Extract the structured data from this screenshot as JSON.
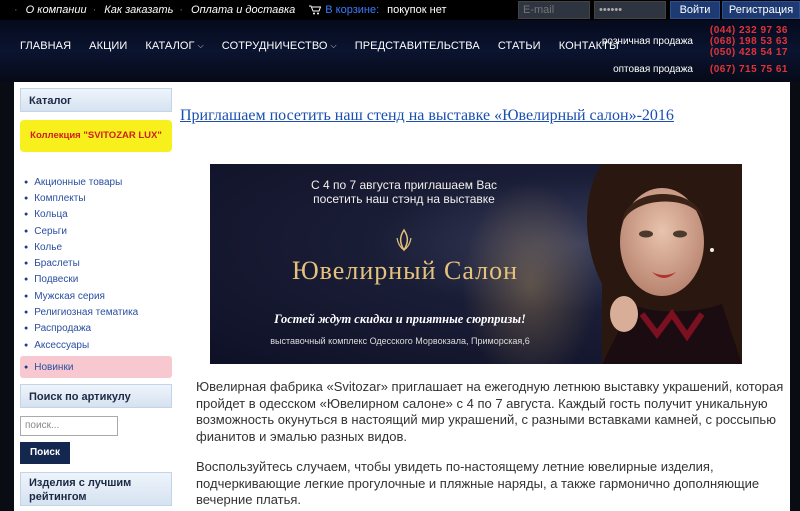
{
  "topbar": {
    "links": [
      "О компании",
      "Как заказать",
      "Оплата и доставка"
    ],
    "cart_label": "В корзине:",
    "cart_status": "покупок нет",
    "email_placeholder": "E-mail",
    "password_mask": "••••••",
    "login_label": "Войти",
    "register_label": "Регистрация"
  },
  "nav": {
    "items": [
      {
        "label": "ГЛАВНАЯ"
      },
      {
        "label": "АКЦИИ"
      },
      {
        "label": "КАТАЛОГ"
      },
      {
        "label": "СОТРУДНИЧЕСТВО"
      },
      {
        "label": "ПРЕДСТАВИТЕЛЬСТВА"
      },
      {
        "label": "СТАТЬИ"
      },
      {
        "label": "КОНТАКТЫ"
      }
    ]
  },
  "phones": {
    "retail_label": "розничная продажа",
    "retail_numbers": [
      "(044) 232 97 36",
      "(068) 198 53 63",
      "(050) 428 54 17"
    ],
    "wholesale_label": "оптовая продажа",
    "wholesale_number": "(067) 715 75 61"
  },
  "sidebar": {
    "catalog_title": "Каталог",
    "promo_label": "Коллекция \"SVITOZAR LUX\"",
    "menu": [
      "Акционные товары",
      "Комплекты",
      "Кольца",
      "Серьги",
      "Колье",
      "Браслеты",
      "Подвески",
      "Мужская серия",
      "Религиозная тематика",
      "Распродажа",
      "Аксессуары",
      "Новинки"
    ],
    "search_title": "Поиск по артикулу",
    "search_placeholder": "поиск...",
    "search_button": "Поиск",
    "rating_title": "Изделия с лучшим рейтингом"
  },
  "article": {
    "title": "Приглашаем посетить наш стенд на выставке «Ювелирный салон»-2016",
    "banner": {
      "line1": "С 4 по 7 августа приглашаем Вас",
      "line2": "посетить наш стэнд на выставке",
      "brand": "Ювелирный Салон",
      "slogan": "Гостей ждут скидки и приятные сюрпризы!",
      "venue": "выставочный комплекс Одесского Морвокзала, Приморская,6"
    },
    "paragraph1": "Ювелирная фабрика «Svitozar» приглашает на ежегодную летнюю выставку украшений, которая пройдет в одесском «Ювелирном салоне» с 4 по 7 августа. Каждый гость получит уникальную возможность окунуться в настоящий мир украшений, с разными вставками камней, с россыпью фианитов и эмалью разных видов.",
    "paragraph2": "Воспользуйтесь случаем, чтобы увидеть по-настоящему летние ювелирные изделия, подчеркивающие легкие прогулочные и пляжные наряды, а также гармонично дополняющие вечерние платья."
  },
  "colors": {
    "accent_blue": "#1a4fb0",
    "phone_red": "#e0343a",
    "promo_yellow": "#f7f01c",
    "active_pink": "#f7c8d0"
  }
}
